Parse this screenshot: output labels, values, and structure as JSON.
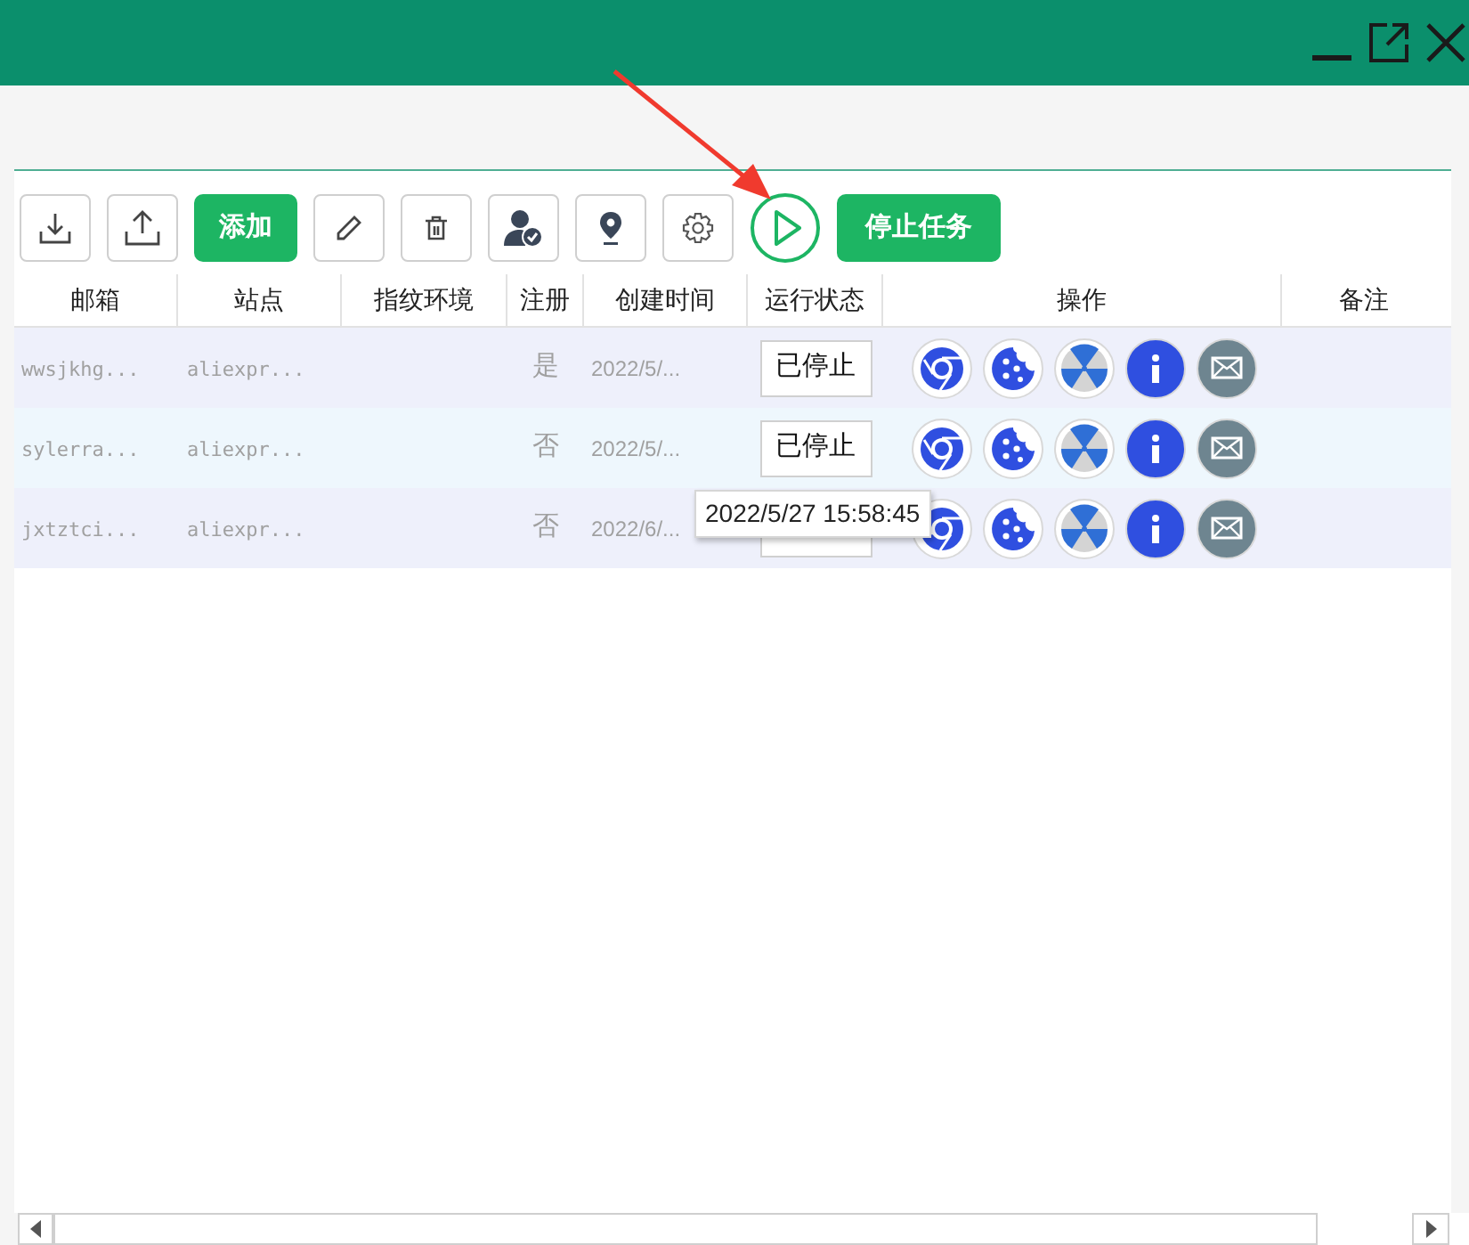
{
  "toolbar": {
    "add_button": "添加",
    "stop_button": "停止任务"
  },
  "table": {
    "columns": [
      "邮箱",
      "站点",
      "指纹环境",
      "注册",
      "创建时间",
      "运行状态",
      "操作",
      "备注"
    ],
    "rows": [
      {
        "email": "wwsjkhg...",
        "site": "aliexpr...",
        "registered": "是",
        "created": "2022/5/...",
        "status": "已停止"
      },
      {
        "email": "sylerra...",
        "site": "aliexpr...",
        "registered": "否",
        "created": "2022/5/...",
        "status": "已停止"
      },
      {
        "email": "jxtztci...",
        "site": "aliexpr...",
        "registered": "否",
        "created": "2022/6/..."
      }
    ]
  },
  "tooltip": "2022/5/27 15:58:45"
}
